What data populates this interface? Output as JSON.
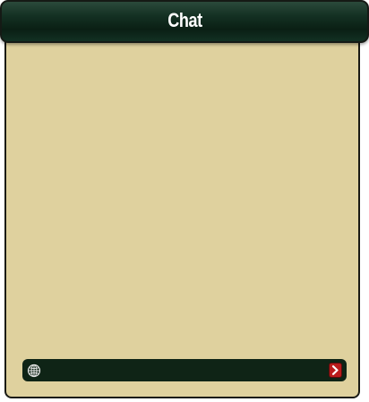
{
  "window": {
    "title": "Chat"
  },
  "messages": [],
  "input": {
    "value": "",
    "placeholder": ""
  },
  "icons": {
    "channel": "globe-icon",
    "send": "chevron-right-icon"
  },
  "colors": {
    "title_bar": "#0f2a1c",
    "panel_background": "#dfd19e",
    "input_bar": "#0f2416",
    "send_button": "#b91c1c",
    "border": "#1a1a14"
  }
}
